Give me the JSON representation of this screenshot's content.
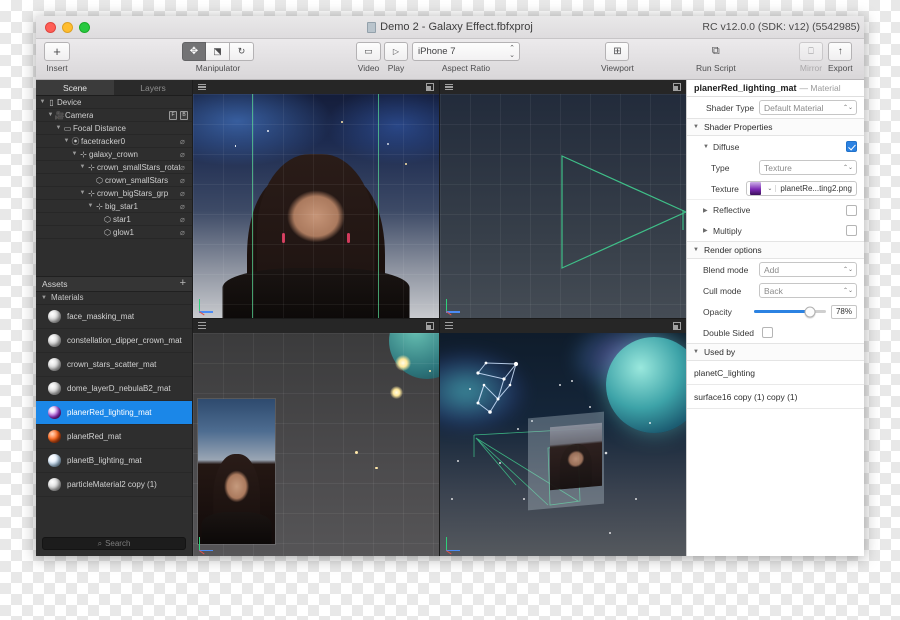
{
  "window": {
    "document_title": "Demo 2 - Galaxy Effect.fbfxproj",
    "version_info": "RC v12.0.0 (SDK: v12) (5542985)",
    "doc_icon": "document-icon",
    "traffic_lights": [
      "close",
      "minimize",
      "zoom"
    ]
  },
  "toolbar": {
    "insert": {
      "label": "Insert",
      "glyph": "+"
    },
    "manipulator": {
      "label": "Manipulator",
      "buttons": [
        {
          "name": "move",
          "glyph": "✤",
          "selected": true
        },
        {
          "name": "scale",
          "glyph": "❐",
          "selected": false
        },
        {
          "name": "rotate",
          "glyph": "↻",
          "selected": false
        }
      ]
    },
    "video": {
      "label": "Video",
      "glyph": "▭"
    },
    "play": {
      "label": "Play",
      "glyph": "▷"
    },
    "aspect_ratio": {
      "label": "Aspect Ratio",
      "value": "iPhone 7"
    },
    "viewport": {
      "label": "Viewport",
      "glyph": "⊞"
    },
    "run_script": {
      "label": "Run Script",
      "glyph": "❐"
    },
    "mirror": {
      "label": "Mirror",
      "glyph": "▢",
      "disabled": true
    },
    "export": {
      "label": "Export",
      "glyph": "↑"
    }
  },
  "sidebar": {
    "tabs": [
      {
        "label": "Scene",
        "active": true
      },
      {
        "label": "Layers",
        "active": false
      }
    ],
    "tree": [
      {
        "label": "Device",
        "indent": 0,
        "disclosure": "▼",
        "icon": "device-icon",
        "eye": false,
        "badges": []
      },
      {
        "label": "Camera",
        "indent": 1,
        "disclosure": "▼",
        "icon": "camera-icon",
        "eye": false,
        "badges": [
          "F",
          "B"
        ]
      },
      {
        "label": "Focal Distance",
        "indent": 2,
        "disclosure": "▼",
        "icon": "ruler-icon",
        "eye": false,
        "badges": []
      },
      {
        "label": "facetracker0",
        "indent": 3,
        "disclosure": "▼",
        "icon": "tracker-icon",
        "eye": true,
        "badges": []
      },
      {
        "label": "galaxy_crown",
        "indent": 4,
        "disclosure": "▼",
        "icon": "null-icon",
        "eye": true,
        "badges": []
      },
      {
        "label": "crown_smallStars_rotator",
        "indent": 5,
        "disclosure": "▼",
        "icon": "null-icon",
        "eye": true,
        "badges": []
      },
      {
        "label": "crown_smallStars",
        "indent": 6,
        "disclosure": "",
        "icon": "mesh-icon",
        "eye": true,
        "badges": []
      },
      {
        "label": "crown_bigStars_grp",
        "indent": 5,
        "disclosure": "▼",
        "icon": "null-icon",
        "eye": true,
        "badges": []
      },
      {
        "label": "big_star1",
        "indent": 6,
        "disclosure": "▼",
        "icon": "null-icon",
        "eye": true,
        "badges": []
      },
      {
        "label": "star1",
        "indent": 7,
        "disclosure": "",
        "icon": "mesh-icon",
        "eye": true,
        "badges": []
      },
      {
        "label": "glow1",
        "indent": 7,
        "disclosure": "",
        "icon": "mesh-icon",
        "eye": true,
        "badges": []
      }
    ],
    "assets": {
      "title": "Assets",
      "add_glyph": "+",
      "group": "Materials",
      "items": [
        {
          "label": "face_masking_mat",
          "swatch": "white",
          "selected": false
        },
        {
          "label": "constellation_dipper_crown_mat",
          "swatch": "white",
          "selected": false
        },
        {
          "label": "crown_stars_scatter_mat",
          "swatch": "white",
          "selected": false
        },
        {
          "label": "dome_layerD_nebulaB2_mat",
          "swatch": "white",
          "selected": false
        },
        {
          "label": "planerRed_lighting_mat",
          "swatch": "purple",
          "selected": true
        },
        {
          "label": "planetRed_mat",
          "swatch": "red",
          "selected": false
        },
        {
          "label": "planetB_lighting_mat",
          "swatch": "blue",
          "selected": false
        },
        {
          "label": "particleMaterial2 copy (1)",
          "swatch": "white",
          "selected": false
        }
      ],
      "search_placeholder": "Search"
    }
  },
  "viewports": [
    {
      "name": "viewport-top-left",
      "menu_icon": "hamburger-icon",
      "expand_icon": "expand-icon"
    },
    {
      "name": "viewport-top-right",
      "menu_icon": "hamburger-icon",
      "expand_icon": "expand-icon"
    },
    {
      "name": "viewport-bottom-left",
      "menu_icon": "hamburger-icon",
      "expand_icon": "expand-icon"
    },
    {
      "name": "viewport-bottom-right",
      "menu_icon": "hamburger-icon",
      "expand_icon": "expand-icon"
    }
  ],
  "inspector": {
    "title": "planerRed_lighting_mat",
    "subtitle": "— Material",
    "shader_type": {
      "label": "Shader Type",
      "value": "Default Material"
    },
    "shader_properties": {
      "label": "Shader Properties"
    },
    "diffuse": {
      "label": "Diffuse",
      "checked": true,
      "type": {
        "label": "Type",
        "value": "Texture"
      },
      "texture": {
        "label": "Texture",
        "value": "planetRe...ting2.png",
        "swatch_color": "#7d2bb5"
      }
    },
    "reflective": {
      "label": "Reflective",
      "checked": false
    },
    "multiply": {
      "label": "Multiply",
      "checked": false
    },
    "render_options": {
      "label": "Render options",
      "blend_mode": {
        "label": "Blend mode",
        "value": "Add"
      },
      "cull_mode": {
        "label": "Cull mode",
        "value": "Back"
      },
      "opacity": {
        "label": "Opacity",
        "value": "78%",
        "percent": 78
      },
      "double_sided": {
        "label": "Double Sided",
        "checked": false
      }
    },
    "used_by": {
      "label": "Used by",
      "items": [
        "planetC_lighting",
        "surface16 copy (1) copy (1)"
      ]
    }
  },
  "colors": {
    "accent": "#2b82e2",
    "selection": "#1b87e8",
    "wire_green": "#3fbf88",
    "panel_dark": "#2e2e2e"
  }
}
